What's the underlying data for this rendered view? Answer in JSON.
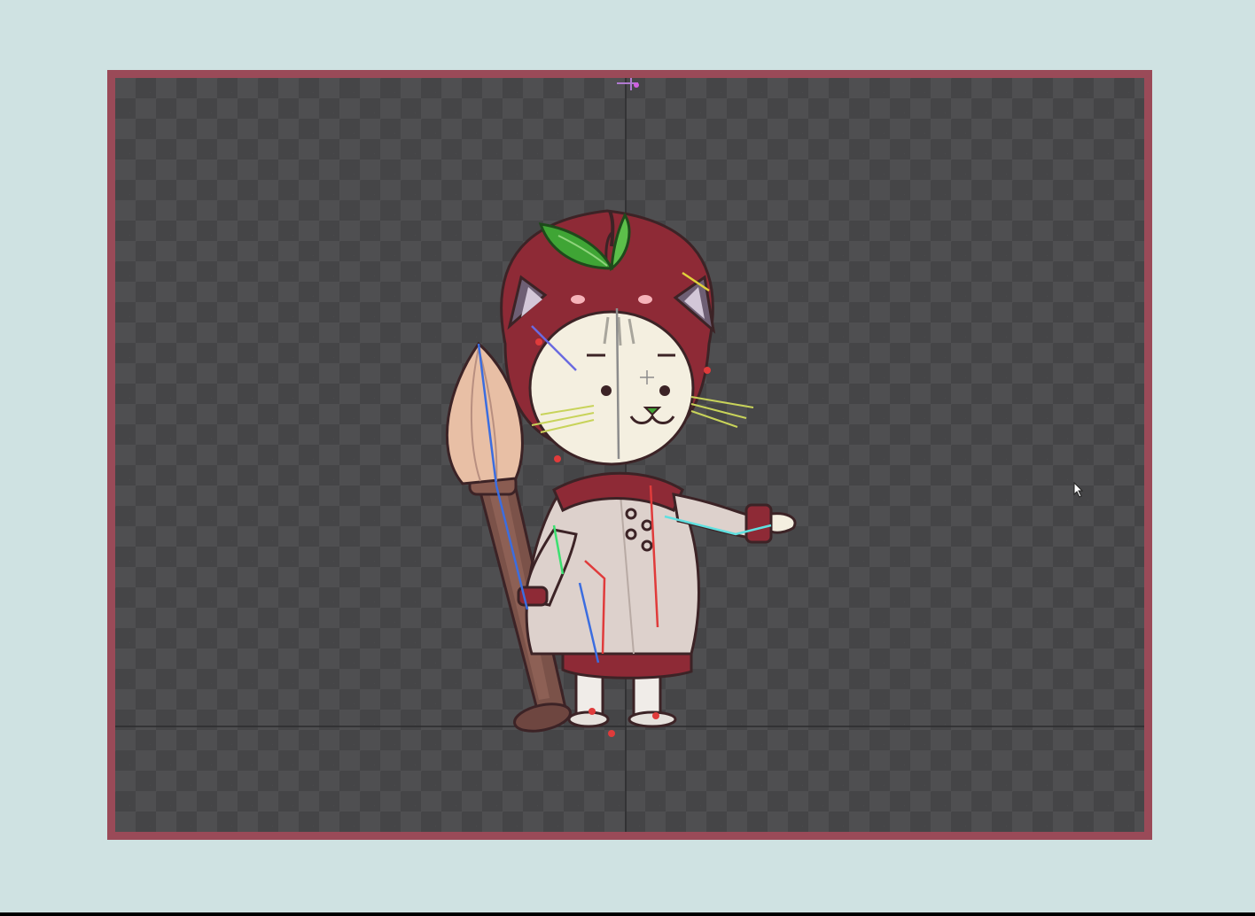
{
  "app": {
    "view": "animation-viewport",
    "background": "#cfe2e2",
    "frame_color": "#9a4a58",
    "canvas_color": "#4f4f51"
  },
  "character": {
    "hat_color": "#8e2a36",
    "leaf_color": "#3fa535",
    "face_color": "#f4efe0",
    "coat_color": "#ddd1cc",
    "brush_handle_color": "#7b5249",
    "brush_tip_color": "#e8bfa5"
  },
  "bones": {
    "colors": [
      "#3b6de0",
      "#e03b3b",
      "#3be070",
      "#e0d13b",
      "#5fe0e0",
      "#d060e0"
    ]
  },
  "guides": {
    "vertical_axis": "visible",
    "ground_line": "visible"
  },
  "icons": {
    "origin": "origin-marker-icon",
    "pointer": "mouse-pointer-icon"
  }
}
